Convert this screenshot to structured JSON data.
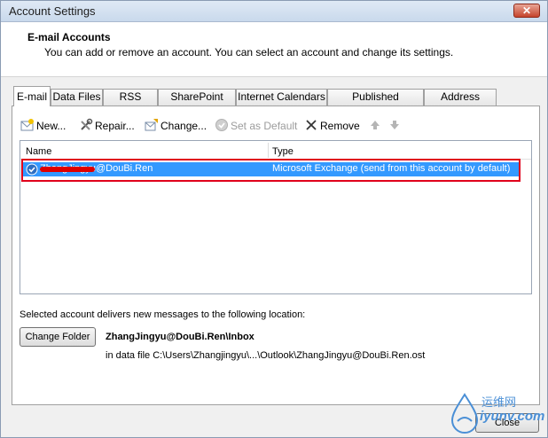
{
  "window": {
    "title": "Account Settings"
  },
  "header": {
    "title": "E-mail Accounts",
    "subtitle": "You can add or remove an account. You can select an account and change its settings."
  },
  "tabs": [
    {
      "label": "E-mail",
      "active": true
    },
    {
      "label": "Data Files"
    },
    {
      "label": "RSS Feeds"
    },
    {
      "label": "SharePoint Lists"
    },
    {
      "label": "Internet Calendars"
    },
    {
      "label": "Published Calendars"
    },
    {
      "label": "Address Books"
    }
  ],
  "toolbar": {
    "new": "New...",
    "repair": "Repair...",
    "change": "Change...",
    "set_default": "Set as Default",
    "remove": "Remove"
  },
  "list": {
    "columns": [
      "Name",
      "Type"
    ],
    "rows": [
      {
        "name": "ZhangJingyu@DouBi.Ren",
        "type": "Microsoft Exchange (send from this account by default)"
      }
    ]
  },
  "delivery": {
    "text": "Selected account delivers new messages to the following location:",
    "change_folder": "Change Folder",
    "location": "ZhangJingyu@DouBi.Ren\\Inbox",
    "data_file": "in data file C:\\Users\\Zhangjingyu\\...\\Outlook\\ZhangJingyu@DouBi.Ren.ost"
  },
  "footer": {
    "close": "Close"
  },
  "watermark": {
    "text": "运维网",
    "domain": "iyunv.com"
  },
  "colors": {
    "selection": "#3399ff",
    "highlight_box": "#e0001b"
  }
}
